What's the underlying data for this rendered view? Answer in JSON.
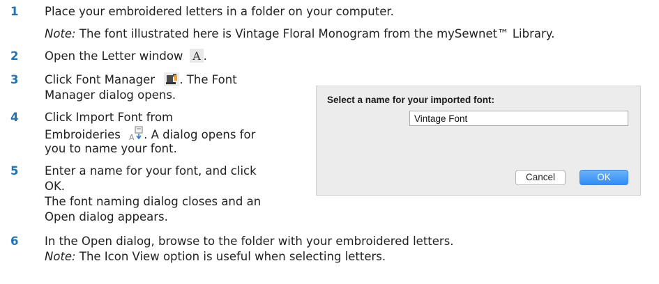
{
  "steps": [
    {
      "number": "1",
      "text": "Place your embroidered letters in a folder on your computer."
    },
    {
      "number": "2",
      "text": "Open the Letter window"
    },
    {
      "number": "3",
      "text_a": "Click Font Manager",
      "text_b": ". The Font",
      "text_c": "Manager dialog opens."
    },
    {
      "number": "4",
      "text_a": "Click Import Font from",
      "text_b": "Embroideries",
      "text_c": ". A dialog opens for",
      "text_d": "you to name your font."
    },
    {
      "number": "5",
      "text_a": "Enter a name for your font, and click",
      "text_b": "OK.",
      "text_c": "The font naming dialog closes and an",
      "text_d": "Open dialog appears."
    },
    {
      "number": "6",
      "text": "In the Open dialog, browse to the folder with your embroidered letters."
    }
  ],
  "notes": [
    {
      "label": "Note:",
      "text": " The font illustrated here is Vintage Floral Monogram from the mySewnet™  Library."
    },
    {
      "label": "Note:",
      "text": " The Icon View option is useful when selecting letters."
    }
  ],
  "punctuation": {
    "period": "."
  },
  "icons": {
    "letter": "letter-A-icon",
    "font_manager": "font-manager-icon",
    "import_font": "import-font-icon"
  },
  "dialog": {
    "title": "Select a name for your imported font:",
    "input_value": "Vintage Font",
    "cancel_label": "Cancel",
    "ok_label": "OK"
  },
  "colors": {
    "step_number": "#1f73b7",
    "ok_button": "#3a8ef6",
    "dialog_bg": "#ececec"
  }
}
